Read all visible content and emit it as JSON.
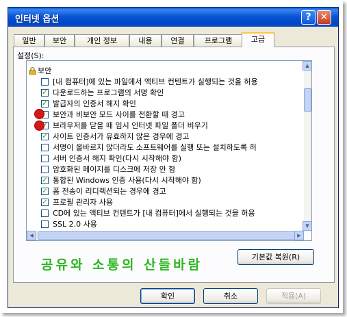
{
  "window": {
    "title": "인터넷 옵션"
  },
  "title_buttons": {
    "help": "?",
    "close": "✕"
  },
  "tabs": [
    {
      "label": "일반"
    },
    {
      "label": "보안"
    },
    {
      "label": "개인 정보"
    },
    {
      "label": "내용"
    },
    {
      "label": "연결"
    },
    {
      "label": "프로그램"
    },
    {
      "label": "고급",
      "active": true
    }
  ],
  "settings": {
    "label": "설정(S):",
    "group": "보안",
    "items": [
      {
        "text": "[내 컴퓨터]에 있는 파일에서 액티브 컨텐트가 실행되는 것을 허용",
        "checked": false
      },
      {
        "text": "다운로드하는 프로그램의 서명 확인",
        "checked": true
      },
      {
        "text": "발급자의 인증서 해지 확인",
        "checked": true
      },
      {
        "text": "보안과 비보안 모드 사이를 전환할 때 경고",
        "checked": false
      },
      {
        "text": "브라우저를 닫을 때 임시 인터넷 파일 폴더 비우기",
        "checked": true
      },
      {
        "text": "사이트 인증서가 유효하지 않은 경우에 경고",
        "checked": true
      },
      {
        "text": "서명이 올바르지 않더라도 소프트웨어를 실행 또는 설치하도록 허",
        "checked": false
      },
      {
        "text": "서버 인증서 해지 확인(다시 시작해야 함)",
        "checked": false
      },
      {
        "text": "암호화된 페이지를 디스크에 저장 안 함",
        "checked": false
      },
      {
        "text": "통합된 Windows 인증 사용(다시 시작해야 함)",
        "checked": true
      },
      {
        "text": "폼 전송이 리디렉션되는 경우에 경고",
        "checked": true
      },
      {
        "text": "프로필 관리자 사용",
        "checked": true
      },
      {
        "text": "CD에 있는 액티브 컨텐트가 [내 컴퓨터]에서 실행되는 것을 허용",
        "checked": false
      },
      {
        "text": "SSL 2.0 사용",
        "checked": false
      }
    ]
  },
  "caption": "공유와 소통의 산들바람",
  "buttons": {
    "restore_defaults": "기본값 복원(R)",
    "ok": "확인",
    "cancel": "취소",
    "apply": "적용(A)"
  },
  "colors": {
    "title_bar": "#0054e3",
    "check": "#21a121",
    "caption": "#2ab820",
    "marker": "#d11a1a"
  }
}
